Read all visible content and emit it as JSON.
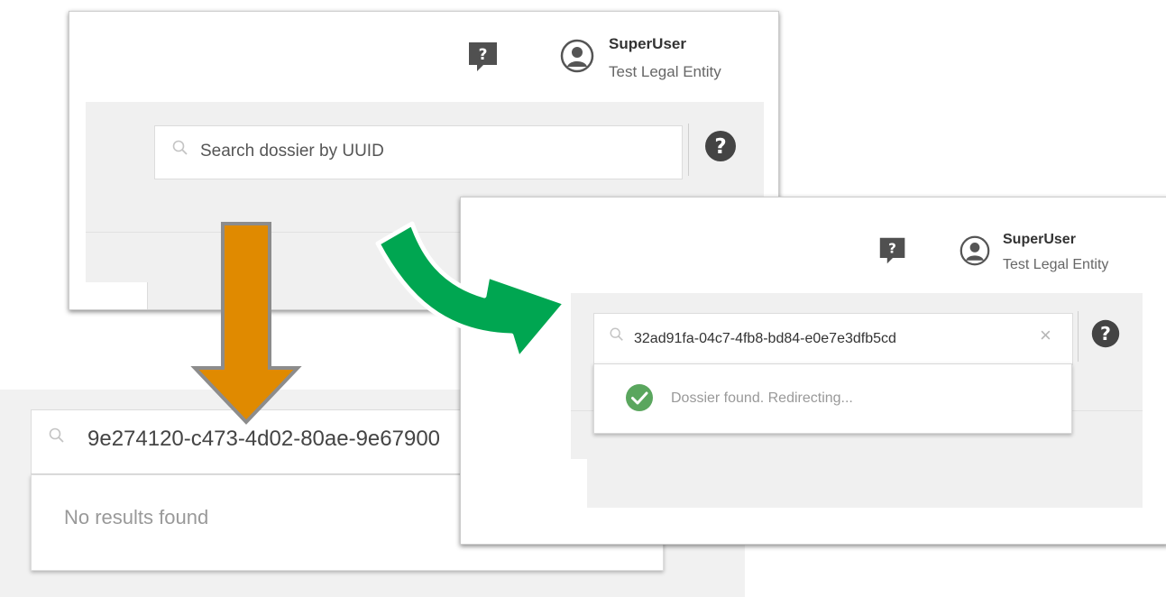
{
  "colors": {
    "orange_arrow": "#e08a00",
    "green_arrow": "#00a651",
    "success_check": "#4caf50",
    "icon_dark": "#444444"
  },
  "panel_search": {
    "user": {
      "name": "SuperUser",
      "entity": "Test Legal Entity",
      "avatar_icon": "user-circle-icon"
    },
    "feedback_icon": "question-bubble-icon",
    "search": {
      "placeholder": "Search dossier by UUID",
      "icon": "search-icon"
    },
    "help_icon": "question-circle-icon"
  },
  "panel_found": {
    "user": {
      "name": "SuperUser",
      "entity": "Test Legal Entity",
      "avatar_icon": "user-circle-icon"
    },
    "feedback_icon": "question-bubble-icon",
    "search": {
      "value": "32ad91fa-04c7-4fb8-bd84-e0e7e3dfb5cd",
      "icon": "search-icon",
      "clear_label": "×"
    },
    "help_icon": "question-circle-icon",
    "result": {
      "text": "Dossier found. Redirecting...",
      "icon": "check-circle-icon"
    }
  },
  "panel_not_found": {
    "search": {
      "value": "9e274120-c473-4d02-80ae-9e67900",
      "icon": "search-icon"
    },
    "result": {
      "text": "No results found"
    }
  },
  "arrows": [
    {
      "name": "down-arrow",
      "color": "orange"
    },
    {
      "name": "curved-arrow",
      "color": "green"
    }
  ]
}
